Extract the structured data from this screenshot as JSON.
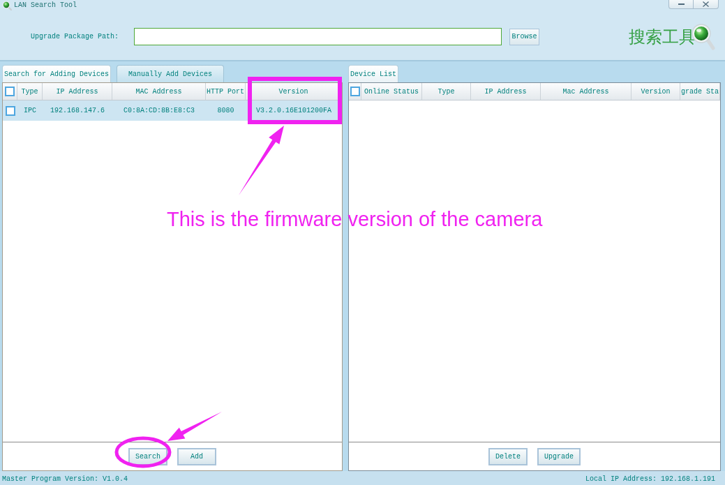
{
  "window": {
    "title": "LAN Search Tool"
  },
  "upgrade_bar": {
    "label": "Upgrade Package Path:",
    "browse_button": "Browse",
    "logo_text": "搜索工具"
  },
  "search_panel": {
    "tabs": [
      {
        "label": "Search for Adding Devices",
        "selected": true
      },
      {
        "label": "Manually Add Devices",
        "selected": false
      }
    ],
    "table": {
      "select_all_checked": false,
      "columns": [
        "Type",
        "IP Address",
        "MAC Address",
        "HTTP Port",
        "Version"
      ],
      "rows": [
        {
          "checked": false,
          "selected": true,
          "cells": [
            "IPC",
            "192.168.147.6",
            "C0:8A:CD:8B:E8:C3",
            "8080",
            "V3.2.0.16E101200FA"
          ]
        }
      ]
    },
    "buttons": [
      "Search",
      "Add"
    ]
  },
  "device_list_panel": {
    "tabs": [
      {
        "label": "Device List",
        "selected": true
      }
    ],
    "table": {
      "select_all_checked": false,
      "columns": [
        "Online Status",
        "Type",
        "IP Address",
        "Mac Address",
        "Version",
        "grade Sta"
      ]
    },
    "buttons": [
      "Delete",
      "Upgrade"
    ]
  },
  "status_bar": {
    "left": "Master Program Version: V1.0.4",
    "right": "Local IP Address: 192.168.1.191"
  },
  "annotation": {
    "note": "This is the firmware version of the camera"
  }
}
